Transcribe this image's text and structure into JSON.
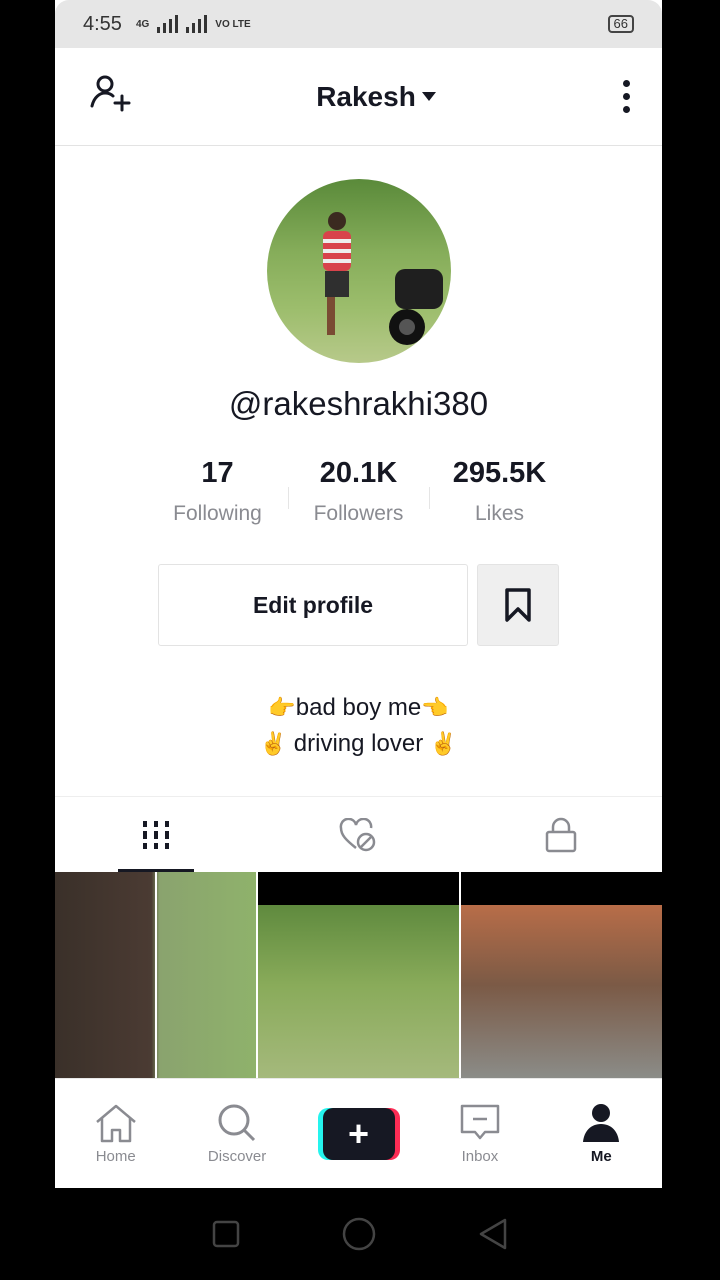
{
  "status_bar": {
    "time": "4:55",
    "network_a": "4G",
    "network_b": "VO LTE",
    "battery": "66"
  },
  "header": {
    "title": "Rakesh"
  },
  "profile": {
    "username": "@rakeshrakhi380"
  },
  "stats": [
    {
      "value": "17",
      "label": "Following"
    },
    {
      "value": "20.1K",
      "label": "Followers"
    },
    {
      "value": "295.5K",
      "label": "Likes"
    }
  ],
  "actions": {
    "edit_label": "Edit profile"
  },
  "bio": {
    "line1": "bad boy me",
    "line2": "driving lover"
  },
  "bottom_nav": {
    "home": "Home",
    "discover": "Discover",
    "inbox": "Inbox",
    "me": "Me"
  },
  "icons": [
    "add-user-icon",
    "more-icon",
    "bookmark-icon",
    "grid-icon",
    "liked-hidden-icon",
    "lock-icon",
    "home-icon",
    "search-icon",
    "plus-icon",
    "inbox-icon",
    "profile-icon"
  ]
}
